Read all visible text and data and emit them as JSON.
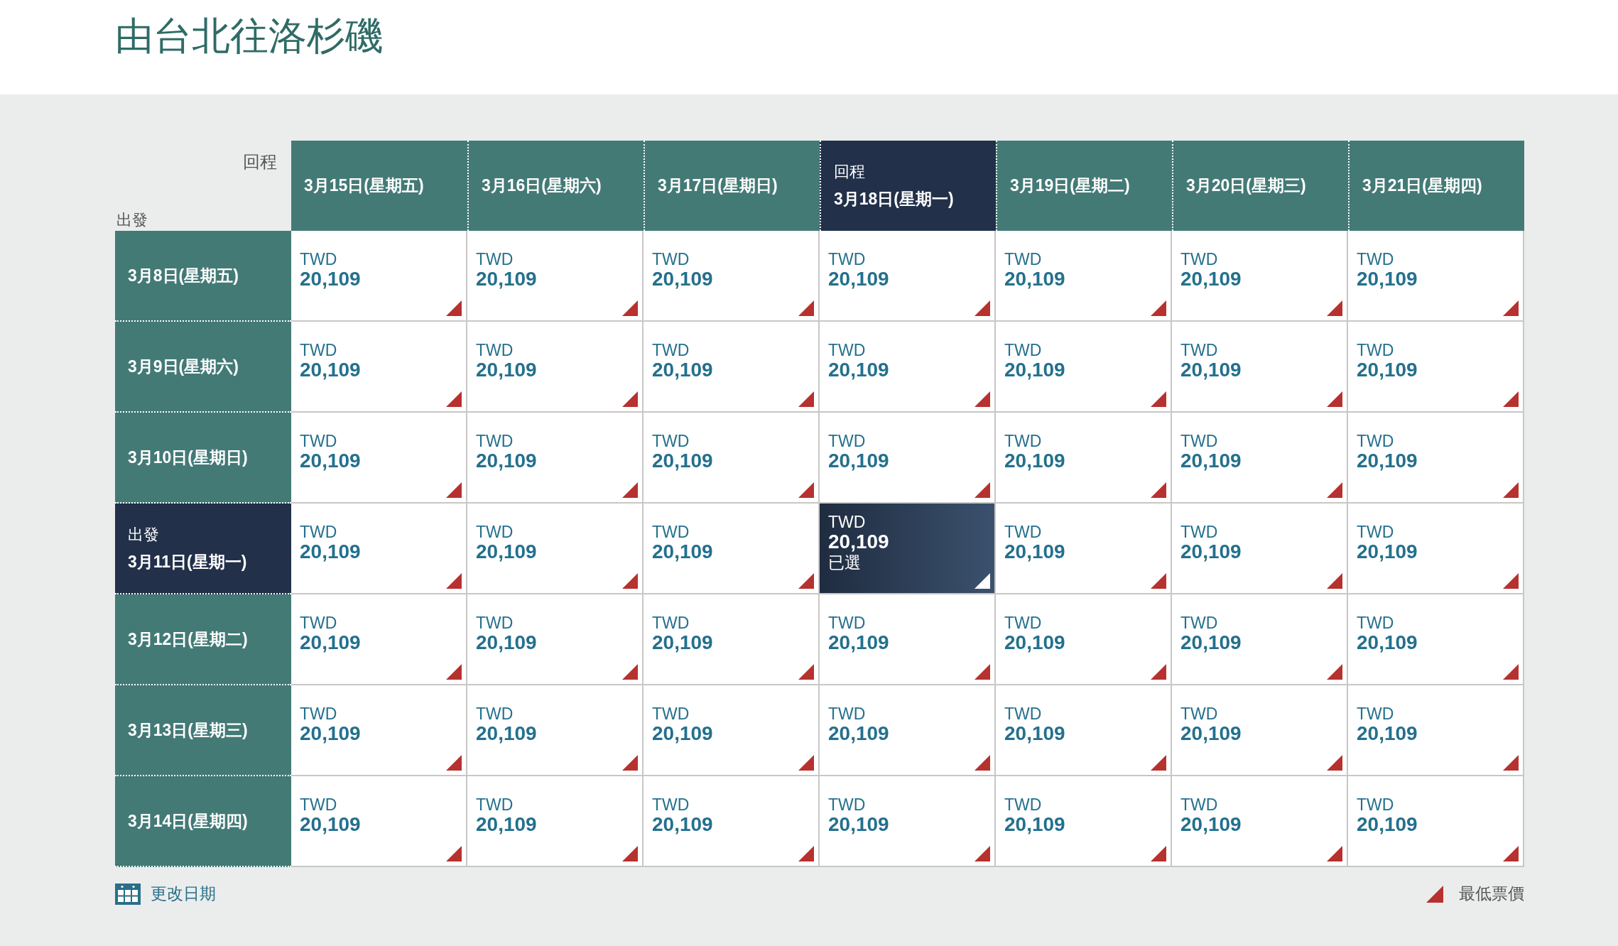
{
  "title": "由台北往洛杉磯",
  "corner": {
    "return_label": "回程",
    "depart_label": "出發"
  },
  "columns": [
    {
      "label": "3月15日(星期五)",
      "selected": false
    },
    {
      "label": "3月16日(星期六)",
      "selected": false
    },
    {
      "label": "3月17日(星期日)",
      "selected": false
    },
    {
      "label": "3月18日(星期一)",
      "selected": true,
      "tag": "回程"
    },
    {
      "label": "3月19日(星期二)",
      "selected": false
    },
    {
      "label": "3月20日(星期三)",
      "selected": false
    },
    {
      "label": "3月21日(星期四)",
      "selected": false
    }
  ],
  "rows": [
    {
      "label": "3月8日(星期五)",
      "selected": false,
      "cells": [
        {
          "currency": "TWD",
          "price": "20,109",
          "lowest": true,
          "selected": false
        },
        {
          "currency": "TWD",
          "price": "20,109",
          "lowest": true,
          "selected": false
        },
        {
          "currency": "TWD",
          "price": "20,109",
          "lowest": true,
          "selected": false
        },
        {
          "currency": "TWD",
          "price": "20,109",
          "lowest": true,
          "selected": false
        },
        {
          "currency": "TWD",
          "price": "20,109",
          "lowest": true,
          "selected": false
        },
        {
          "currency": "TWD",
          "price": "20,109",
          "lowest": true,
          "selected": false
        },
        {
          "currency": "TWD",
          "price": "20,109",
          "lowest": true,
          "selected": false
        }
      ]
    },
    {
      "label": "3月9日(星期六)",
      "selected": false,
      "cells": [
        {
          "currency": "TWD",
          "price": "20,109",
          "lowest": true,
          "selected": false
        },
        {
          "currency": "TWD",
          "price": "20,109",
          "lowest": true,
          "selected": false
        },
        {
          "currency": "TWD",
          "price": "20,109",
          "lowest": true,
          "selected": false
        },
        {
          "currency": "TWD",
          "price": "20,109",
          "lowest": true,
          "selected": false
        },
        {
          "currency": "TWD",
          "price": "20,109",
          "lowest": true,
          "selected": false
        },
        {
          "currency": "TWD",
          "price": "20,109",
          "lowest": true,
          "selected": false
        },
        {
          "currency": "TWD",
          "price": "20,109",
          "lowest": true,
          "selected": false
        }
      ]
    },
    {
      "label": "3月10日(星期日)",
      "selected": false,
      "cells": [
        {
          "currency": "TWD",
          "price": "20,109",
          "lowest": true,
          "selected": false
        },
        {
          "currency": "TWD",
          "price": "20,109",
          "lowest": true,
          "selected": false
        },
        {
          "currency": "TWD",
          "price": "20,109",
          "lowest": true,
          "selected": false
        },
        {
          "currency": "TWD",
          "price": "20,109",
          "lowest": true,
          "selected": false
        },
        {
          "currency": "TWD",
          "price": "20,109",
          "lowest": true,
          "selected": false
        },
        {
          "currency": "TWD",
          "price": "20,109",
          "lowest": true,
          "selected": false
        },
        {
          "currency": "TWD",
          "price": "20,109",
          "lowest": true,
          "selected": false
        }
      ]
    },
    {
      "label": "3月11日(星期一)",
      "selected": true,
      "tag": "出發",
      "cells": [
        {
          "currency": "TWD",
          "price": "20,109",
          "lowest": true,
          "selected": false
        },
        {
          "currency": "TWD",
          "price": "20,109",
          "lowest": true,
          "selected": false
        },
        {
          "currency": "TWD",
          "price": "20,109",
          "lowest": true,
          "selected": false
        },
        {
          "currency": "TWD",
          "price": "20,109",
          "lowest": true,
          "selected": true,
          "status": "已選"
        },
        {
          "currency": "TWD",
          "price": "20,109",
          "lowest": true,
          "selected": false
        },
        {
          "currency": "TWD",
          "price": "20,109",
          "lowest": true,
          "selected": false
        },
        {
          "currency": "TWD",
          "price": "20,109",
          "lowest": true,
          "selected": false
        }
      ]
    },
    {
      "label": "3月12日(星期二)",
      "selected": false,
      "cells": [
        {
          "currency": "TWD",
          "price": "20,109",
          "lowest": true,
          "selected": false
        },
        {
          "currency": "TWD",
          "price": "20,109",
          "lowest": true,
          "selected": false
        },
        {
          "currency": "TWD",
          "price": "20,109",
          "lowest": true,
          "selected": false
        },
        {
          "currency": "TWD",
          "price": "20,109",
          "lowest": true,
          "selected": false
        },
        {
          "currency": "TWD",
          "price": "20,109",
          "lowest": true,
          "selected": false
        },
        {
          "currency": "TWD",
          "price": "20,109",
          "lowest": true,
          "selected": false
        },
        {
          "currency": "TWD",
          "price": "20,109",
          "lowest": true,
          "selected": false
        }
      ]
    },
    {
      "label": "3月13日(星期三)",
      "selected": false,
      "cells": [
        {
          "currency": "TWD",
          "price": "20,109",
          "lowest": true,
          "selected": false
        },
        {
          "currency": "TWD",
          "price": "20,109",
          "lowest": true,
          "selected": false
        },
        {
          "currency": "TWD",
          "price": "20,109",
          "lowest": true,
          "selected": false
        },
        {
          "currency": "TWD",
          "price": "20,109",
          "lowest": true,
          "selected": false
        },
        {
          "currency": "TWD",
          "price": "20,109",
          "lowest": true,
          "selected": false
        },
        {
          "currency": "TWD",
          "price": "20,109",
          "lowest": true,
          "selected": false
        },
        {
          "currency": "TWD",
          "price": "20,109",
          "lowest": true,
          "selected": false
        }
      ]
    },
    {
      "label": "3月14日(星期四)",
      "selected": false,
      "cells": [
        {
          "currency": "TWD",
          "price": "20,109",
          "lowest": true,
          "selected": false
        },
        {
          "currency": "TWD",
          "price": "20,109",
          "lowest": true,
          "selected": false
        },
        {
          "currency": "TWD",
          "price": "20,109",
          "lowest": true,
          "selected": false
        },
        {
          "currency": "TWD",
          "price": "20,109",
          "lowest": true,
          "selected": false
        },
        {
          "currency": "TWD",
          "price": "20,109",
          "lowest": true,
          "selected": false
        },
        {
          "currency": "TWD",
          "price": "20,109",
          "lowest": true,
          "selected": false
        },
        {
          "currency": "TWD",
          "price": "20,109",
          "lowest": true,
          "selected": false
        }
      ]
    }
  ],
  "footer": {
    "change_dates": "更改日期",
    "legend": "最低票價"
  }
}
